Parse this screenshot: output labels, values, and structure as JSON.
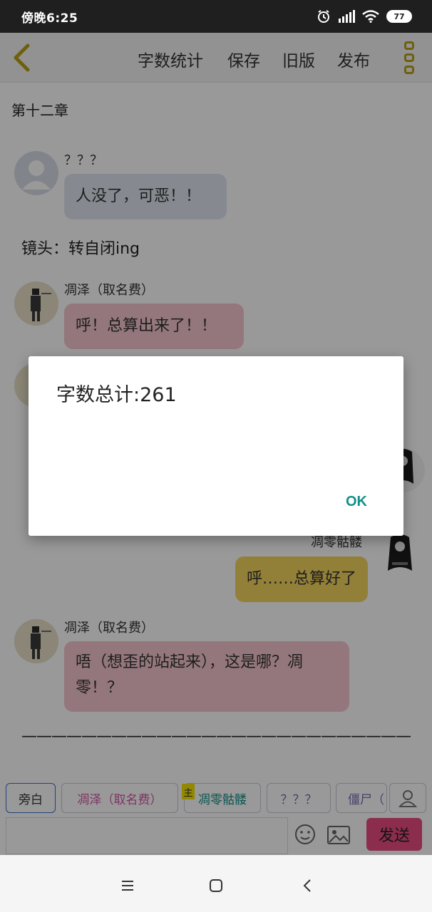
{
  "status_bar": {
    "time": "傍晚6:25",
    "battery": "77"
  },
  "toolbar": {
    "items": [
      {
        "label": "字数统计"
      },
      {
        "label": "保存"
      },
      {
        "label": "旧版"
      },
      {
        "label": "发布"
      }
    ]
  },
  "chapter_title": "第十二章",
  "messages": [
    {
      "speaker": "？？？",
      "text": "人没了，可恶！！"
    },
    {
      "speaker": "凋泽（取名费）",
      "text": "呼！总算出来了！！"
    },
    {
      "speaker": "凋零骷髅",
      "text": "呼……总算好了"
    },
    {
      "speaker": "凋泽（取名费）",
      "text_line1": "唔（想歪的站起来），这是哪？凋",
      "text_line2": "零！？"
    }
  ],
  "narration": "镜头：转自闭ing",
  "divider": "——————————————————————————",
  "characters": {
    "chips": [
      {
        "label": "旁白"
      },
      {
        "label": "凋泽（取名费）"
      },
      {
        "label": "凋零骷髅"
      },
      {
        "label": "？？？"
      },
      {
        "label": "僵尸（"
      }
    ],
    "host_badge": "主"
  },
  "input": {
    "placeholder": ""
  },
  "send_label": "发送",
  "dialog": {
    "message": "字数总计:261",
    "ok_label": "OK"
  },
  "colors": {
    "accent_gold": "#b7a018",
    "pink_bubble": "#f7c6cf",
    "yellow_bubble": "#f3d55e",
    "gray_bubble": "#e0e7f0",
    "send_button": "#e94c80",
    "ok_text": "#139089"
  },
  "icons": {
    "back": "chevron-left-icon",
    "more": "more-vertical-icon",
    "user": "user-icon",
    "emoji": "emoji-icon",
    "image": "image-icon"
  }
}
